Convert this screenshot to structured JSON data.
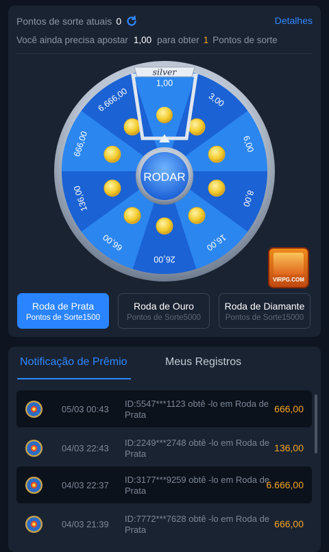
{
  "header": {
    "points_label": "Pontos de sorte atuais",
    "points_value": "0",
    "details_label": "Detalhes",
    "need_prefix": "Você ainda precisa apostar",
    "need_amount": "1,00",
    "need_middle": "para obter",
    "need_points": "1",
    "need_suffix": "Pontos de sorte"
  },
  "wheel": {
    "badge": "silver",
    "button_label": "RODAR",
    "prizes": [
      "1,00",
      "3,00",
      "6,00",
      "8,00",
      "16,00",
      "26,00",
      "66,00",
      "136,00",
      "666,00",
      "6.666,00"
    ]
  },
  "logo": {
    "text": "VIRPG.COM"
  },
  "tiers": [
    {
      "title": "Roda de Prata",
      "subtitle": "Pontos de Sorte1500",
      "active": true
    },
    {
      "title": "Roda de Ouro",
      "subtitle": "Pontos de Sorte5000",
      "active": false
    },
    {
      "title": "Roda de Diamante",
      "subtitle": "Pontos de Sorte15000",
      "active": false
    }
  ],
  "tabs": {
    "notification": "Notificação de Prêmio",
    "records": "Meus Registros"
  },
  "notifications": [
    {
      "date": "05/03 00:43",
      "desc": "ID:5547***1123 obtê -lo em Roda de Prata",
      "value": "666,00"
    },
    {
      "date": "04/03 22:43",
      "desc": "ID:2249***2748 obtê -lo em Roda de Prata",
      "value": "136,00"
    },
    {
      "date": "04/03 22:37",
      "desc": "ID:3177***9259 obtê -lo em Roda de Prata",
      "value": "6.666,00"
    },
    {
      "date": "04/03 21:39",
      "desc": "ID:7772***7628 obtê -lo em Roda de Prata",
      "value": "666,00"
    }
  ],
  "colors": {
    "accent": "#2f88ff",
    "prize": "#f5a623",
    "wheel_blue": "#1e6fe0"
  }
}
